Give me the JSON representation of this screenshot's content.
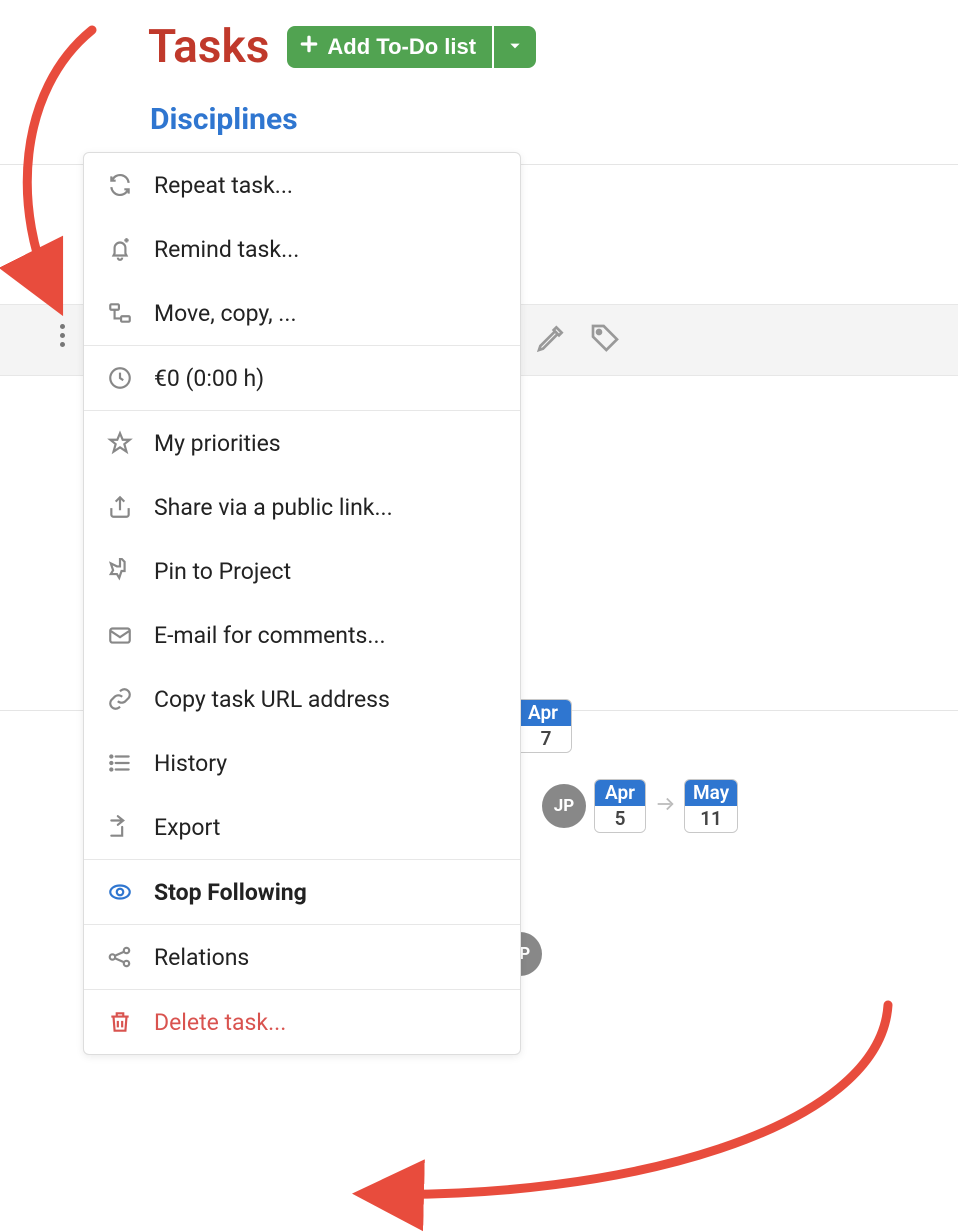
{
  "header": {
    "title": "Tasks",
    "add_button_label": "Add To-Do list",
    "subtitle": "Disciplines"
  },
  "avatars": {
    "initials": "JP"
  },
  "dates": {
    "row1": {
      "month": "Apr",
      "day": "7"
    },
    "row2_start": {
      "month": "Apr",
      "day": "5"
    },
    "row2_end": {
      "month": "May",
      "day": "11"
    }
  },
  "menu": {
    "repeat": "Repeat task...",
    "remind": "Remind task...",
    "move": "Move, copy, ...",
    "time": "€0 (0:00 h)",
    "priorities": "My priorities",
    "share": "Share via a public link...",
    "pin": "Pin to Project",
    "email": "E-mail for comments...",
    "copyurl": "Copy task URL address",
    "history": "History",
    "export": "Export",
    "stopfollowing": "Stop Following",
    "relations": "Relations",
    "delete": "Delete task..."
  }
}
